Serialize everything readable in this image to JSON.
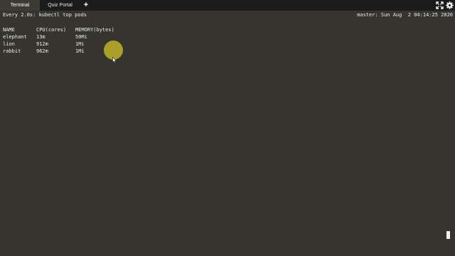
{
  "tabs": [
    {
      "label": "Terminal",
      "active": true
    },
    {
      "label": "Quiz Portal",
      "active": false
    }
  ],
  "toolbar": {
    "add_tab_label": "+",
    "icons": [
      "fullscreen-icon",
      "gear-icon"
    ]
  },
  "terminal": {
    "header_left": "Every 2.0s: kubectl top pods",
    "header_right": "master: Sun Aug  2 04:14:25 2020",
    "columns": [
      "NAME",
      "CPU(cores)",
      "MEMORY(bytes)"
    ],
    "rows": [
      {
        "name": "elephant",
        "cpu": "13m",
        "memory": "50Mi"
      },
      {
        "name": "lion",
        "cpu": "912m",
        "memory": "1Mi"
      },
      {
        "name": "rabbit",
        "cpu": "962m",
        "memory": "1Mi"
      }
    ]
  },
  "colors": {
    "tabbar_bg": "#1b1b1b",
    "active_tab_bg": "#3b3a35",
    "terminal_bg": "#35342f",
    "terminal_text": "#ececec",
    "cursor_highlight": "#beb428"
  }
}
